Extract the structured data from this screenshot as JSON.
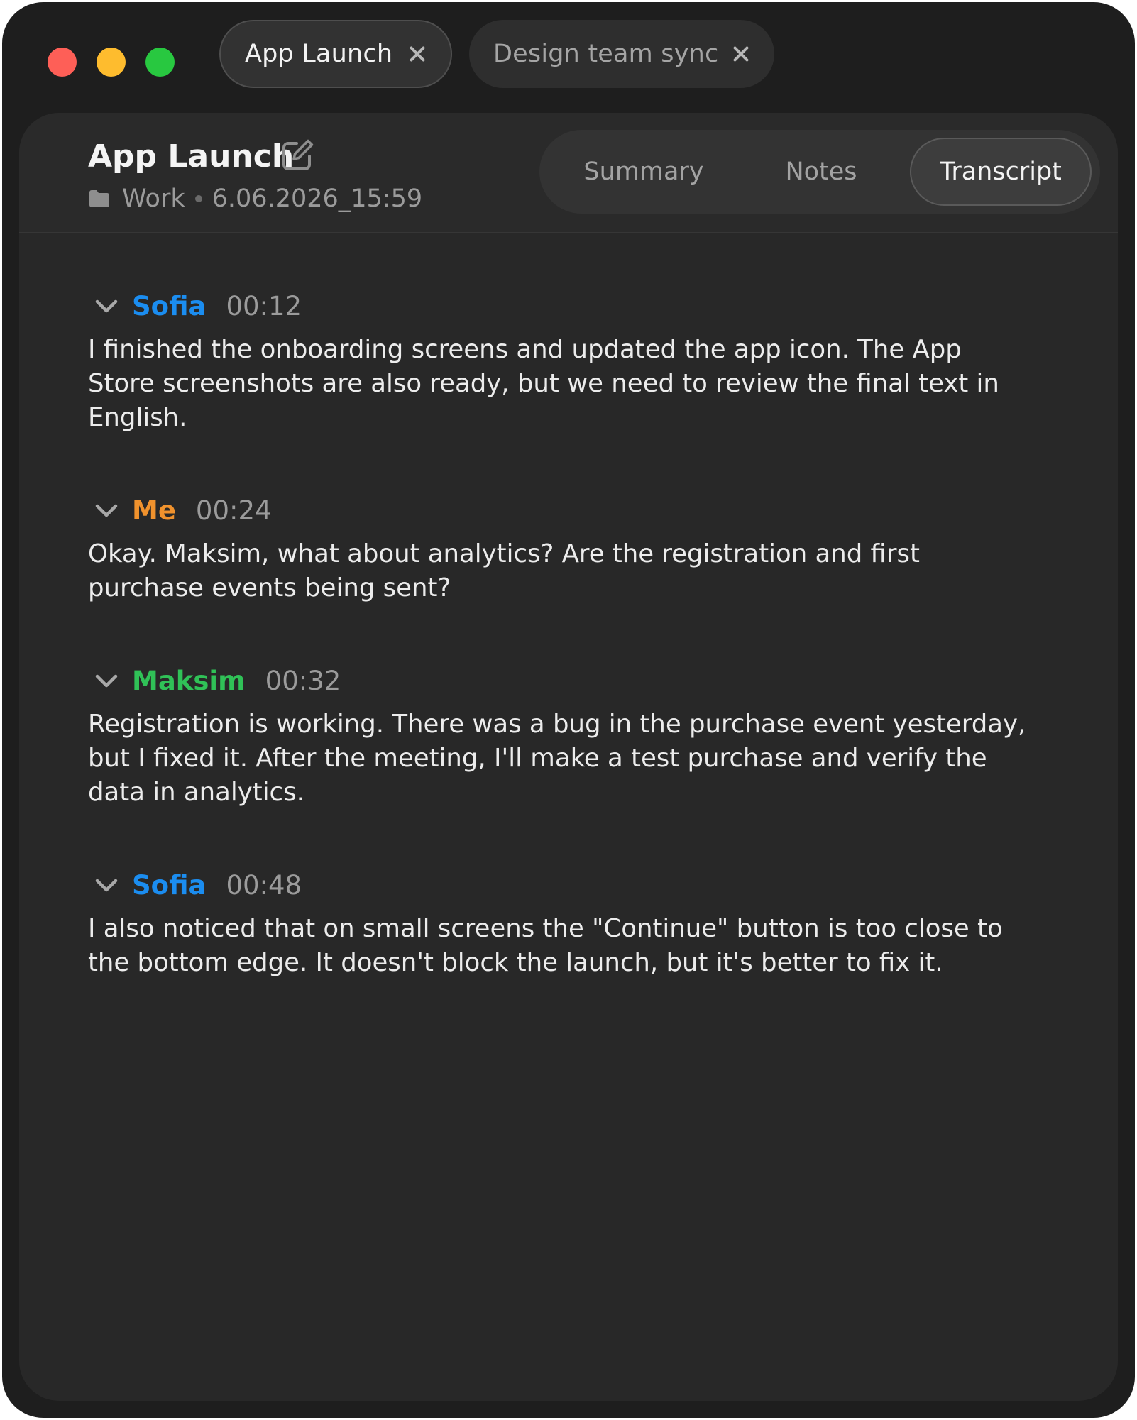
{
  "tabs": [
    {
      "label": "App Launch",
      "active": true
    },
    {
      "label": "Design team sync",
      "active": false
    }
  ],
  "header": {
    "title": "App Launch",
    "folder": "Work",
    "date": "6.06.2026_15:59"
  },
  "view_tabs": {
    "summary": "Summary",
    "notes": "Notes",
    "transcript": "Transcript",
    "selected": "Transcript"
  },
  "colors": {
    "sofia": "#1b8df0",
    "me": "#f0922d",
    "maksim": "#30c157"
  },
  "transcript": [
    {
      "speaker": "Sofia",
      "time": "00:12",
      "text": "I finished the onboarding screens and updated the app icon. The App Store screenshots are also ready, but we need to review the final text in English."
    },
    {
      "speaker": "Me",
      "time": "00:24",
      "text": "Okay. Maksim, what about analytics? Are the registration and first purchase events being sent?"
    },
    {
      "speaker": "Maksim",
      "time": "00:32",
      "text": "Registration is working. There was a bug in the purchase event yesterday, but I fixed it. After the meeting, I'll make a test purchase and verify the data in analytics."
    },
    {
      "speaker": "Sofia",
      "time": "00:48",
      "text": "I also noticed that on small screens the \"Continue\" button is too close to the bottom edge. It doesn't block the launch, but it's better to fix it."
    }
  ]
}
